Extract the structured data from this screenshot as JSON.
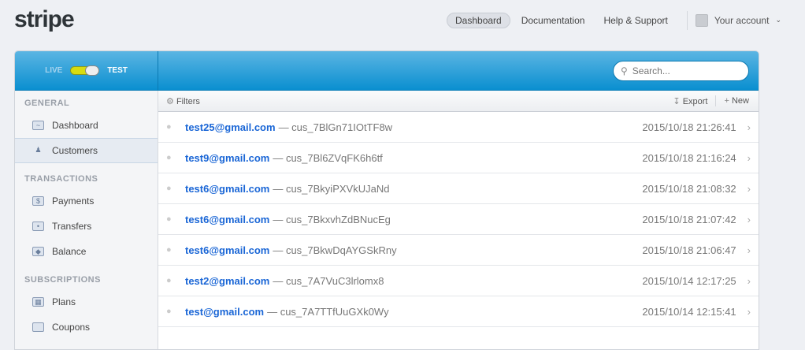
{
  "logo": "stripe",
  "topnav": {
    "items": [
      "Dashboard",
      "Documentation",
      "Help & Support"
    ],
    "account": "Your account"
  },
  "mode": {
    "live": "LIVE",
    "test": "TEST"
  },
  "search": {
    "placeholder": "Search..."
  },
  "sidebar": {
    "sections": [
      {
        "title": "GENERAL",
        "items": [
          "Dashboard",
          "Customers"
        ]
      },
      {
        "title": "TRANSACTIONS",
        "items": [
          "Payments",
          "Transfers",
          "Balance"
        ]
      },
      {
        "title": "SUBSCRIPTIONS",
        "items": [
          "Plans",
          "Coupons"
        ]
      }
    ]
  },
  "toolbar": {
    "filters": "Filters",
    "export": "Export",
    "new": "New"
  },
  "customers": [
    {
      "email": "test25@gmail.com",
      "id": "— cus_7BlGn71IOtTF8w",
      "date": "2015/10/18 21:26:41"
    },
    {
      "email": "test9@gmail.com",
      "id": "— cus_7Bl6ZVqFK6h6tf",
      "date": "2015/10/18 21:16:24"
    },
    {
      "email": "test6@gmail.com",
      "id": "— cus_7BkyiPXVkUJaNd",
      "date": "2015/10/18 21:08:32"
    },
    {
      "email": "test6@gmail.com",
      "id": "— cus_7BkxvhZdBNucEg",
      "date": "2015/10/18 21:07:42"
    },
    {
      "email": "test6@gmail.com",
      "id": "— cus_7BkwDqAYGSkRny",
      "date": "2015/10/18 21:06:47"
    },
    {
      "email": "test2@gmail.com",
      "id": "— cus_7A7VuC3lrlomx8",
      "date": "2015/10/14 12:17:25"
    },
    {
      "email": "test@gmail.com",
      "id": "— cus_7A7TTfUuGXk0Wy",
      "date": "2015/10/14 12:15:41"
    }
  ]
}
